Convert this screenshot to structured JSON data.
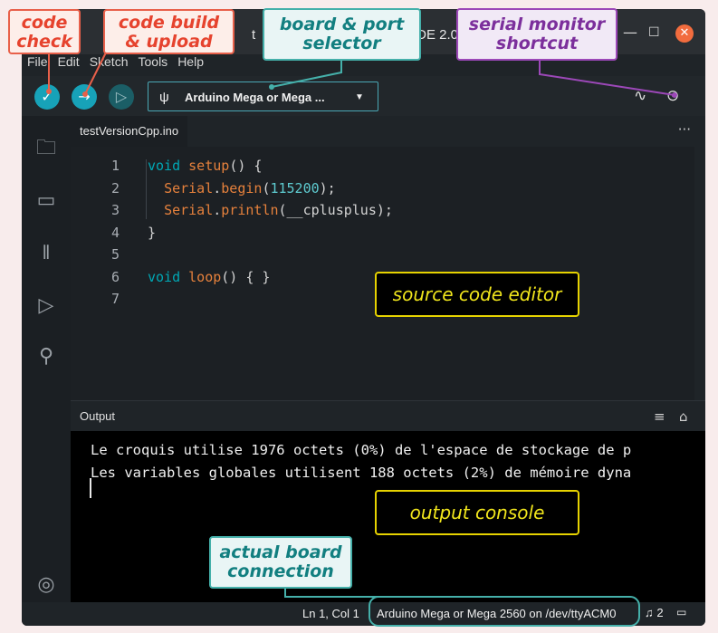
{
  "window": {
    "title_start": "t",
    "title_end": "DE 2.0"
  },
  "menu": [
    "File",
    "Edit",
    "Sketch",
    "Tools",
    "Help"
  ],
  "toolbar": {
    "board_name": "Arduino Mega or Mega ..."
  },
  "editor": {
    "tab_name": "testVersionCpp.ino",
    "more": "···",
    "line_numbers": [
      "1",
      "2",
      "3",
      "4",
      "5",
      "6",
      "7"
    ],
    "code": [
      [
        {
          "t": "void",
          "c": "kw"
        },
        {
          "t": " "
        },
        {
          "t": "setup",
          "c": "fn"
        },
        {
          "t": "() {"
        }
      ],
      [
        {
          "t": "  "
        },
        {
          "t": "Serial",
          "c": "cls"
        },
        {
          "t": "."
        },
        {
          "t": "begin",
          "c": "fn"
        },
        {
          "t": "("
        },
        {
          "t": "115200",
          "c": "num"
        },
        {
          "t": ");"
        }
      ],
      [
        {
          "t": "  "
        },
        {
          "t": "Serial",
          "c": "cls"
        },
        {
          "t": "."
        },
        {
          "t": "println",
          "c": "fn"
        },
        {
          "t": "(__cplusplus);"
        }
      ],
      [
        {
          "t": "}"
        }
      ],
      [
        {
          "t": ""
        }
      ],
      [
        {
          "t": "void",
          "c": "kw"
        },
        {
          "t": " "
        },
        {
          "t": "loop",
          "c": "fn"
        },
        {
          "t": "() { }"
        }
      ],
      [
        {
          "t": ""
        }
      ]
    ]
  },
  "output": {
    "title": "Output",
    "lines": [
      "Le croquis utilise 1976 octets (0%) de l'espace de stockage de p",
      "Les variables globales utilisent 188 octets (2%) de mémoire dyna"
    ]
  },
  "status": {
    "position": "Ln 1, Col 1",
    "connection": "Arduino Mega or Mega 2560 on /dev/ttyACM0",
    "notifications": "2"
  },
  "callouts": {
    "code_check": [
      "code",
      "check"
    ],
    "code_build": [
      "code build",
      "& upload"
    ],
    "board_port": [
      "board & port",
      "selector"
    ],
    "serial_monitor": [
      "serial monitor",
      "shortcut"
    ],
    "source_editor": "source code editor",
    "output_console": "output console",
    "board_connection": [
      "actual board",
      "connection"
    ]
  },
  "colors": {
    "accent": "#17a2b8",
    "callout_red": "#e6432e",
    "callout_teal": "#127f80",
    "callout_purple": "#7c2f9c",
    "callout_yellow": "#f1e61c"
  },
  "icons": {
    "verify": "check-icon",
    "upload": "arrow-right-icon",
    "debug": "debug-icon",
    "plotter": "serial-plotter-icon",
    "monitor": "serial-monitor-icon",
    "sidebar": [
      "folder-icon",
      "boards-icon",
      "library-icon",
      "debug-icon",
      "search-icon",
      "account-icon"
    ]
  }
}
